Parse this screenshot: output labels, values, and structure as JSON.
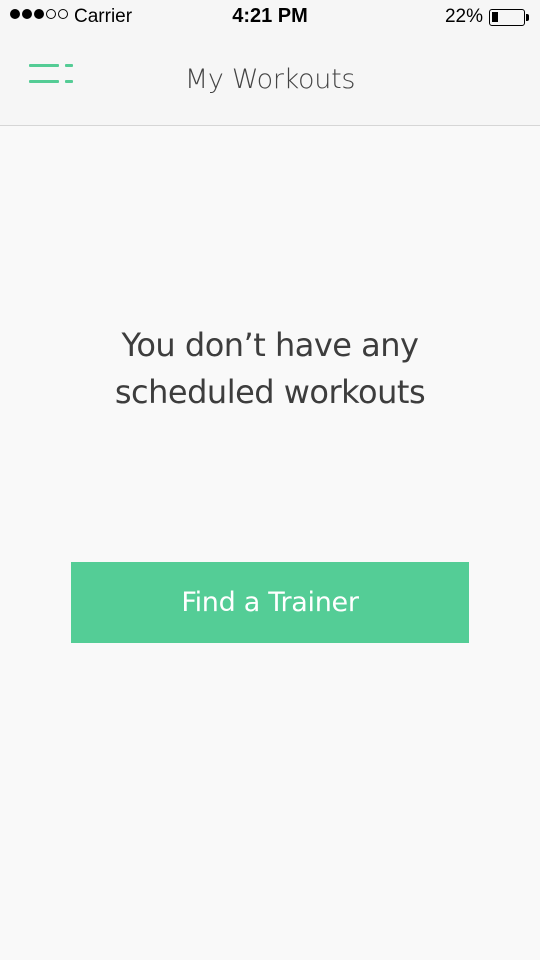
{
  "status_bar": {
    "signal_filled": 3,
    "signal_total": 5,
    "carrier": "Carrier",
    "time": "4:21 PM",
    "battery_percent": "22%",
    "battery_level": 0.22
  },
  "nav": {
    "menu_icon": "menu-icon",
    "title": "My Workouts"
  },
  "empty_state": {
    "line1": "You don’t have any",
    "line2": "scheduled workouts"
  },
  "cta": {
    "label": "Find a Trainer"
  },
  "colors": {
    "accent": "#54cd96",
    "background": "#f9f9f9",
    "nav_background": "#f6f6f6",
    "text": "#3d3d3d"
  }
}
